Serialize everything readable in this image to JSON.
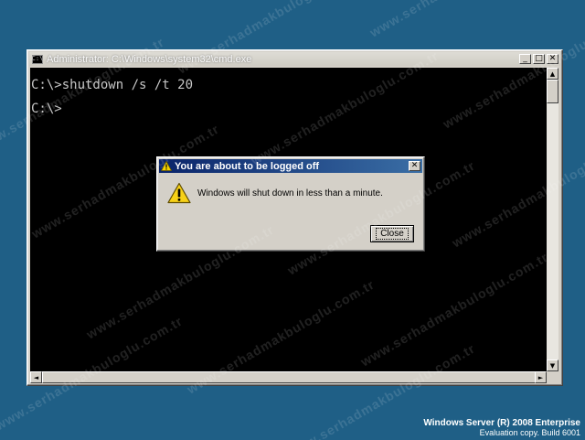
{
  "console_window": {
    "title": "Administrator: C:\\Windows\\system32\\cmd.exe",
    "icon": "console-app-icon",
    "icon_text": "C:\\",
    "minimize_glyph": "_",
    "maximize_glyph": "□",
    "close_glyph": "✕",
    "lines": [
      "C:\\>shutdown /s /t 20",
      "C:\\>"
    ],
    "scroll_up_glyph": "▲",
    "scroll_down_glyph": "▼",
    "scroll_left_glyph": "◄",
    "scroll_right_glyph": "►"
  },
  "dialog": {
    "title": "You are about to be logged off",
    "message": "Windows will shut down in less than a minute.",
    "close_button_label": "Close",
    "close_glyph": "✕",
    "icon": "warning-icon"
  },
  "branding": {
    "product": "Windows Server (R) 2008 Enterprise",
    "build": "Evaluation copy. Build 6001"
  },
  "watermark_text": "www.serhadmakbuloglu.com.tr",
  "colors": {
    "desktop": "#1f5f86",
    "console_bg": "#000000",
    "console_text": "#c6c6c6",
    "dialog_title": "#0a246a"
  }
}
